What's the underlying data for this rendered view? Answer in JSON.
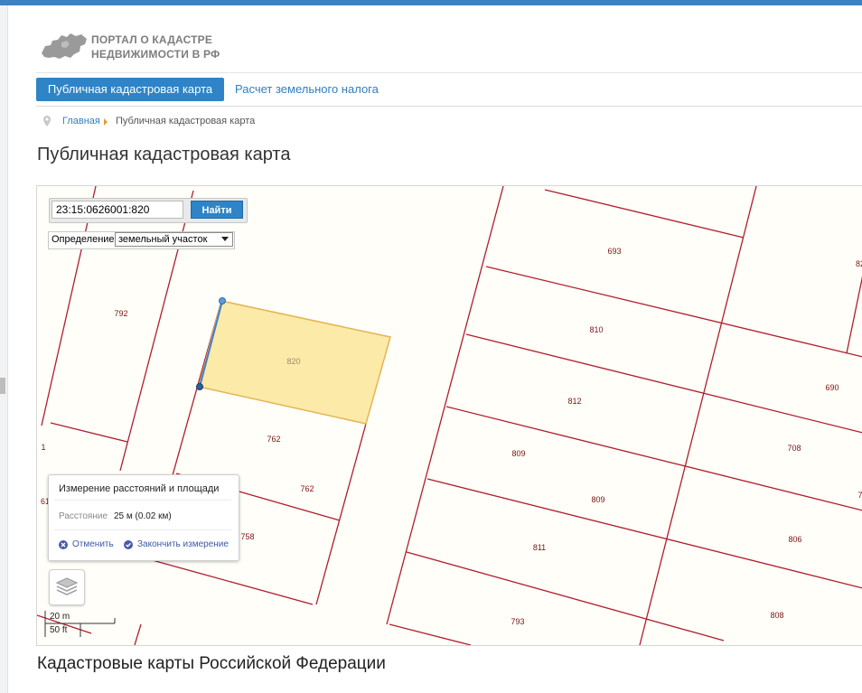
{
  "header": {
    "logo_line1": "ПОРТАЛ О КАДАСТРЕ",
    "logo_line2": "НЕДВИЖИМОСТИ В РФ"
  },
  "nav": {
    "tab_active": "Публичная кадастровая карта",
    "tab_other": "Расчет земельного налога"
  },
  "breadcrumb": {
    "home": "Главная",
    "current": "Публичная кадастровая карта"
  },
  "page_title": "Публичная кадастровая карта",
  "map": {
    "search_value": "23:15:0626001:820",
    "search_button": "Найти",
    "definition_label": "Определение:",
    "definition_value": "земельный участок",
    "parcel_labels": [
      "792",
      "820",
      "762",
      "762",
      "758",
      "693",
      "810",
      "812",
      "809",
      "809",
      "811",
      "793",
      "690",
      "708",
      "806",
      "808",
      "82",
      "1",
      "61",
      "7"
    ],
    "measure": {
      "title": "Измерение расстояний и площади",
      "distance_label": "Расстояние",
      "distance_value": "25 м (0.02 км)",
      "cancel": "Отменить",
      "finish": "Закончить измерение"
    },
    "scale_m": "20 m",
    "scale_ft": "50 ft",
    "colors": {
      "parcel_border": "#b01e2e",
      "label": "#7a1414",
      "highlight_fill": "#fbeaa8",
      "highlight_stroke": "#e6b454",
      "measure_line": "#3d7fd0"
    }
  },
  "section_title": "Кадастровые карты Российской Федерации"
}
